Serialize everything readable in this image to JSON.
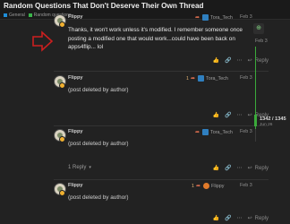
{
  "header": {
    "title": "Random Questions That Don't Deserve Their Own Thread",
    "breadcrumbs": [
      {
        "label": "General",
        "color": "#1e8ed9"
      },
      {
        "label": "Random questions",
        "color": "#3ab54a"
      }
    ]
  },
  "arrow_color": "#cc1f1f",
  "posts": [
    {
      "author": "Flippy",
      "reply_to": {
        "label": "Tora_Tech",
        "icon": "user-avatar-icon"
      },
      "date": "Feb 3",
      "text": "Thanks, it won't work unless it's modified. I remember someone once posting a modified one that would work...could have been back on apps4flip... lol",
      "reply_label": "Reply"
    },
    {
      "author": "Flippy",
      "reply_count": "1",
      "reply_to": {
        "label": "Tora_Tech",
        "icon": "user-avatar-icon"
      },
      "date": "Feb 3",
      "text": "(post deleted by author)",
      "reply_label": "Reply"
    },
    {
      "author": "Flippy",
      "reply_to": {
        "label": "Tora_Tech",
        "icon": "user-avatar-icon"
      },
      "date": "Feb 3",
      "text": "(post deleted by author)",
      "reply_label": "Reply",
      "replies_summary": "1 Reply"
    },
    {
      "author": "Flippy",
      "reply_count": "1",
      "reply_to": {
        "label": "Flippy",
        "icon": "fire-avatar-icon"
      },
      "date": "Feb 3",
      "text": "(post deleted by author)",
      "reply_label": "Reply"
    }
  ],
  "timeline": {
    "start_date": "Feb 3",
    "position": "1342 / 1345",
    "position_date": "Jun 26",
    "progress": 0.9978,
    "bar_color": "#3aaa3a"
  }
}
